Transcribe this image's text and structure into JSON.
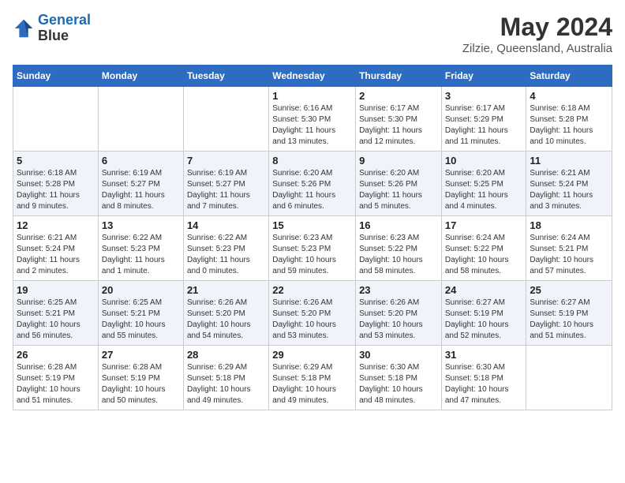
{
  "header": {
    "logo_line1": "General",
    "logo_line2": "Blue",
    "main_title": "May 2024",
    "subtitle": "Zilzie, Queensland, Australia"
  },
  "days_of_week": [
    "Sunday",
    "Monday",
    "Tuesday",
    "Wednesday",
    "Thursday",
    "Friday",
    "Saturday"
  ],
  "weeks": [
    [
      {
        "day": "",
        "info": ""
      },
      {
        "day": "",
        "info": ""
      },
      {
        "day": "",
        "info": ""
      },
      {
        "day": "1",
        "info": "Sunrise: 6:16 AM\nSunset: 5:30 PM\nDaylight: 11 hours\nand 13 minutes."
      },
      {
        "day": "2",
        "info": "Sunrise: 6:17 AM\nSunset: 5:30 PM\nDaylight: 11 hours\nand 12 minutes."
      },
      {
        "day": "3",
        "info": "Sunrise: 6:17 AM\nSunset: 5:29 PM\nDaylight: 11 hours\nand 11 minutes."
      },
      {
        "day": "4",
        "info": "Sunrise: 6:18 AM\nSunset: 5:28 PM\nDaylight: 11 hours\nand 10 minutes."
      }
    ],
    [
      {
        "day": "5",
        "info": "Sunrise: 6:18 AM\nSunset: 5:28 PM\nDaylight: 11 hours\nand 9 minutes."
      },
      {
        "day": "6",
        "info": "Sunrise: 6:19 AM\nSunset: 5:27 PM\nDaylight: 11 hours\nand 8 minutes."
      },
      {
        "day": "7",
        "info": "Sunrise: 6:19 AM\nSunset: 5:27 PM\nDaylight: 11 hours\nand 7 minutes."
      },
      {
        "day": "8",
        "info": "Sunrise: 6:20 AM\nSunset: 5:26 PM\nDaylight: 11 hours\nand 6 minutes."
      },
      {
        "day": "9",
        "info": "Sunrise: 6:20 AM\nSunset: 5:26 PM\nDaylight: 11 hours\nand 5 minutes."
      },
      {
        "day": "10",
        "info": "Sunrise: 6:20 AM\nSunset: 5:25 PM\nDaylight: 11 hours\nand 4 minutes."
      },
      {
        "day": "11",
        "info": "Sunrise: 6:21 AM\nSunset: 5:24 PM\nDaylight: 11 hours\nand 3 minutes."
      }
    ],
    [
      {
        "day": "12",
        "info": "Sunrise: 6:21 AM\nSunset: 5:24 PM\nDaylight: 11 hours\nand 2 minutes."
      },
      {
        "day": "13",
        "info": "Sunrise: 6:22 AM\nSunset: 5:23 PM\nDaylight: 11 hours\nand 1 minute."
      },
      {
        "day": "14",
        "info": "Sunrise: 6:22 AM\nSunset: 5:23 PM\nDaylight: 11 hours\nand 0 minutes."
      },
      {
        "day": "15",
        "info": "Sunrise: 6:23 AM\nSunset: 5:23 PM\nDaylight: 10 hours\nand 59 minutes."
      },
      {
        "day": "16",
        "info": "Sunrise: 6:23 AM\nSunset: 5:22 PM\nDaylight: 10 hours\nand 58 minutes."
      },
      {
        "day": "17",
        "info": "Sunrise: 6:24 AM\nSunset: 5:22 PM\nDaylight: 10 hours\nand 58 minutes."
      },
      {
        "day": "18",
        "info": "Sunrise: 6:24 AM\nSunset: 5:21 PM\nDaylight: 10 hours\nand 57 minutes."
      }
    ],
    [
      {
        "day": "19",
        "info": "Sunrise: 6:25 AM\nSunset: 5:21 PM\nDaylight: 10 hours\nand 56 minutes."
      },
      {
        "day": "20",
        "info": "Sunrise: 6:25 AM\nSunset: 5:21 PM\nDaylight: 10 hours\nand 55 minutes."
      },
      {
        "day": "21",
        "info": "Sunrise: 6:26 AM\nSunset: 5:20 PM\nDaylight: 10 hours\nand 54 minutes."
      },
      {
        "day": "22",
        "info": "Sunrise: 6:26 AM\nSunset: 5:20 PM\nDaylight: 10 hours\nand 53 minutes."
      },
      {
        "day": "23",
        "info": "Sunrise: 6:26 AM\nSunset: 5:20 PM\nDaylight: 10 hours\nand 53 minutes."
      },
      {
        "day": "24",
        "info": "Sunrise: 6:27 AM\nSunset: 5:19 PM\nDaylight: 10 hours\nand 52 minutes."
      },
      {
        "day": "25",
        "info": "Sunrise: 6:27 AM\nSunset: 5:19 PM\nDaylight: 10 hours\nand 51 minutes."
      }
    ],
    [
      {
        "day": "26",
        "info": "Sunrise: 6:28 AM\nSunset: 5:19 PM\nDaylight: 10 hours\nand 51 minutes."
      },
      {
        "day": "27",
        "info": "Sunrise: 6:28 AM\nSunset: 5:19 PM\nDaylight: 10 hours\nand 50 minutes."
      },
      {
        "day": "28",
        "info": "Sunrise: 6:29 AM\nSunset: 5:18 PM\nDaylight: 10 hours\nand 49 minutes."
      },
      {
        "day": "29",
        "info": "Sunrise: 6:29 AM\nSunset: 5:18 PM\nDaylight: 10 hours\nand 49 minutes."
      },
      {
        "day": "30",
        "info": "Sunrise: 6:30 AM\nSunset: 5:18 PM\nDaylight: 10 hours\nand 48 minutes."
      },
      {
        "day": "31",
        "info": "Sunrise: 6:30 AM\nSunset: 5:18 PM\nDaylight: 10 hours\nand 47 minutes."
      },
      {
        "day": "",
        "info": ""
      }
    ]
  ]
}
